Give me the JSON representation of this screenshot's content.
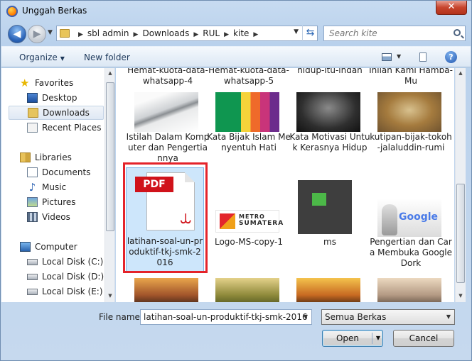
{
  "window": {
    "title": "Unggah Berkas",
    "close_label": "✕"
  },
  "address": {
    "crumbs": [
      "sbl admin",
      "Downloads",
      "RUL",
      "kite"
    ],
    "search_placeholder": "Search kite"
  },
  "toolbar": {
    "organize": "Organize",
    "new_folder": "New folder",
    "help": "?"
  },
  "nav": {
    "favorites": {
      "label": "Favorites",
      "items": [
        "Desktop",
        "Downloads",
        "Recent Places"
      ]
    },
    "libraries": {
      "label": "Libraries",
      "items": [
        "Documents",
        "Music",
        "Pictures",
        "Videos"
      ]
    },
    "computer": {
      "label": "Computer",
      "items": [
        "Local Disk (C:)",
        "Local Disk (D:)",
        "Local Disk (E:)"
      ]
    },
    "selected": "Downloads"
  },
  "files": {
    "row0": [
      "Hemat-kuota-data-whatsapp-4",
      "Hemat-kuota-data-whatsapp-5",
      "hidup-itu-indah",
      "Inilah Kami Hamba-Mu"
    ],
    "row1": [
      "Istilah Dalam Komputer dan Pengertiannya",
      "Kata Bijak Islam Menyentuh Hati",
      "Kata Motivasi Untuk Kerasnya Hidup",
      "kutipan-bijak-tokoh-jalaluddin-rumi"
    ],
    "row2": [
      "latihan-soal-un-produktif-tkj-smk-2016",
      "Logo-MS-copy-1",
      "ms",
      "Pengertian dan Cara Membuka Google Dork"
    ],
    "pdf_label": "PDF",
    "metro_line1": "METRO",
    "metro_line2": "SUMATERA",
    "google_word": "Google"
  },
  "bottom": {
    "file_name_label": "File name:",
    "file_name_value": "latihan-soal-un-produktif-tkj-smk-2016",
    "filter_value": "Semua Berkas",
    "open_label": "Open",
    "cancel_label": "Cancel"
  }
}
